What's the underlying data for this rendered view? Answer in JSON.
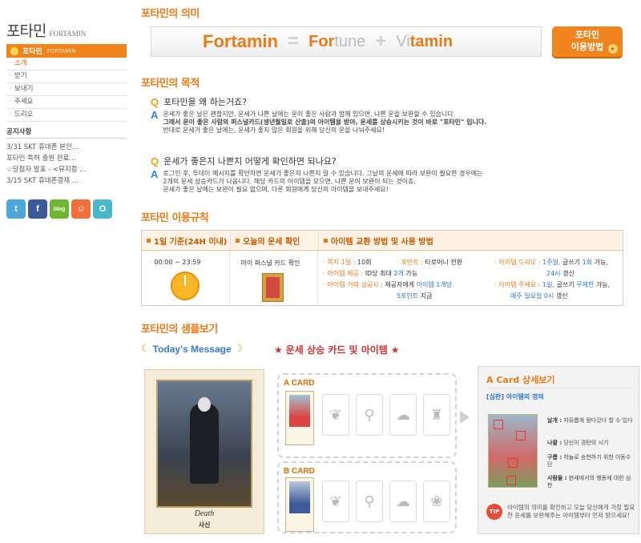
{
  "sidebar": {
    "brand_ko": "포타민",
    "brand_en": "FORTAMIN",
    "active_ko": "포타민",
    "active_en": "FORTAMIN",
    "menu": [
      "소개",
      "받기",
      "보내기",
      "주세요",
      "드리오"
    ],
    "notice_title": "공지사항",
    "notices": [
      "3/31 SKT 휴대폰 본인...",
      "포타민 특허 출원 완료...",
      "☆당첨자 발표 - <뮤지컬 ...",
      "3/15 SKT 휴대폰결제 ..."
    ],
    "social": [
      {
        "icon": "twitter-icon",
        "glyph": "t",
        "color": "#4aa7d8"
      },
      {
        "icon": "facebook-icon",
        "glyph": "f",
        "color": "#3b5a9a"
      },
      {
        "icon": "blog-icon",
        "glyph": "blog",
        "color": "#6fb633"
      },
      {
        "icon": "me2day-icon",
        "glyph": "☺",
        "color": "#f06f3a"
      },
      {
        "icon": "yozm-icon",
        "glyph": "O",
        "color": "#49b8c8"
      }
    ]
  },
  "meaning": {
    "title": "포타민의 의미",
    "formula": {
      "word": "Fortamin",
      "eq": "=",
      "plus": "+",
      "fortune_bold": "For",
      "fortune_rest": "tune",
      "vitamin_rest": "Vi",
      "vitamin_bold": "tamin"
    },
    "usage_button": {
      "line1": "포타민",
      "line2": "이용방법"
    }
  },
  "purpose": {
    "title": "포타민의 목적",
    "q1": "포타민을 왜 하는거죠?",
    "a1": [
      "운세가 좋은 날은 괜찮지만, 운세가 나쁜 날에는 운이 좋은 사람과 함께 있으면, 나쁜 운을 보완할 수 있습니다.",
      "그래서 운이 좋은 사람의 퍼스널카드(생년월일로 산출)의 아이템을 받아, 운세를 상승시키는 것이 바로 \"포타민\" 입니다.",
      "반대로 운세가 좋은 날에는, 운세가 좋지 않은 회원을 위해 당신의 운을 나눠주세요!"
    ],
    "q2": "운세가 좋은지 나쁜지 어떻게 확인하면 되나요?",
    "a2": [
      "로그인 후, 투데이 메시지를 확인하면 운세가 좋은지 나쁜지 알 수 있습니다. 그날의 운세에 따라 보완이 필요한 경우에는",
      "2개의 운세 상승카드가 나옵니다. 해당 카드의 아이템을 모으면, 나쁜 운이 보완이 되는 것이죠.",
      "운세가 좋은 날에는 보완이 필요 없으며, 다른 회원에게 당신의 아이템을 보내주세요!"
    ]
  },
  "rules": {
    "title": "포타민 이용규칙",
    "h1": "1일 기준(24H 이내)",
    "h2": "오늘의 운세 확인",
    "h3": "아이템 교환 방법 및 사용 방법",
    "time": "00:00 ~ 23:59",
    "card_check": "마이 퍼스널 카드 확인",
    "r_note_label": "쪽지 1일 :",
    "r_note_val": "10회",
    "r_item_label": "아이템 제공 :",
    "r_item_val1": "ID당 최대",
    "r_item_val2": "2개",
    "r_item_val3": "가능",
    "r_trade_label": "아이템 거래 성공시 :",
    "r_trade_val1": "제공자에게",
    "r_trade_val2": "아이템 1개당",
    "r_trade_val3": "5포인트",
    "r_trade_val4": "지급",
    "r_point_label": "포인트 :",
    "r_point_val": "타로머니 전환",
    "r_drio_label": "아이템 드리오 :",
    "r_drio_v1": "1주일,",
    "r_drio_v2": "글쓰기",
    "r_drio_v3": "1회",
    "r_drio_v4": "가능,",
    "r_drio_v5": "24시",
    "r_drio_v6": "갱신",
    "r_juse_label": "아이템 주세요 :",
    "r_juse_v1": "1일,",
    "r_juse_v2": "글쓰기",
    "r_juse_v3": "무제한",
    "r_juse_v4": "가능,",
    "r_juse_v5": "매주 일요일 0시",
    "r_juse_v6": "갱신"
  },
  "sample": {
    "title": "포타민의 샘플보기",
    "todays_message": "Today's Message",
    "cards_items": "운세 상승 카드 및 아이템",
    "big_card_en": "Death",
    "big_card_ko": "사신",
    "a_card": "A CARD",
    "b_card": "B CARD",
    "detail_title": "A Card 상세보기",
    "detail_sub": "[심판] 아이템의 정의",
    "labels": [
      {
        "k": "날개 :",
        "v": "자유롭게 왕다갔다 할 수 있다"
      },
      {
        "k": "나팔 :",
        "v": "당신이 경탄의 시기"
      },
      {
        "k": "구름 :",
        "v": "하늘로 승천하기 위한 이동수단"
      },
      {
        "k": "사람들 :",
        "v": "현세에서의 행동에 대한 심판"
      }
    ],
    "tip_badge": "TIP",
    "tip_text": "아이템의 의미를 확인하고 오늘 당신에게 가장 필요한 운세를 보완해주는 아이템부터 먼저 받으세요!"
  }
}
